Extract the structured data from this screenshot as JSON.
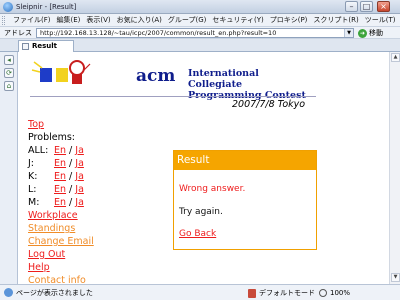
{
  "window": {
    "title": "Sleipnir - [Result]",
    "minimize": "–",
    "maximize": "□",
    "close": "×"
  },
  "menu": {
    "items": [
      "ファイル(F)",
      "編集(E)",
      "表示(V)",
      "お気に入り(A)",
      "グループ(G)",
      "セキュリティ(Y)",
      "プロキシ(P)",
      "スクリプト(R)",
      "ツール(T)",
      "ウィ"
    ]
  },
  "address": {
    "label": "アドレス",
    "url": "http://192.168.13.128/~tau/icpc/2007/common/result_en.php?result=10",
    "dropdown": "▼",
    "go_icon": "➜",
    "go_label": "移動"
  },
  "tabs": [
    {
      "label": "Result"
    }
  ],
  "sidebar": {
    "buttons": [
      "◂",
      "⟳",
      "⌂"
    ]
  },
  "page": {
    "acm": "acm",
    "icpc": "International Collegiate\nProgramming Contest",
    "date": "2007/7/8 Tokyo",
    "nav": {
      "top": "Top",
      "problems": "Problems:",
      "problem_rows": [
        {
          "key": "ALL:",
          "en": "En",
          "sep": " / ",
          "ja": "Ja"
        },
        {
          "key": "J:",
          "en": "En",
          "sep": " / ",
          "ja": "Ja"
        },
        {
          "key": "K:",
          "en": "En",
          "sep": " / ",
          "ja": "Ja"
        },
        {
          "key": "L:",
          "en": "En",
          "sep": " / ",
          "ja": "Ja"
        },
        {
          "key": "M:",
          "en": "En",
          "sep": " / ",
          "ja": "Ja"
        }
      ],
      "workplace": "Workplace",
      "standings": "Standings",
      "change_email": "Change Email",
      "logout": "Log Out",
      "help": "Help",
      "contact": "Contact info"
    },
    "result": {
      "header": "Result",
      "message": "Wrong answer.",
      "retry": "Try again.",
      "goback": "Go Back"
    }
  },
  "status": {
    "text": "ページが表示されました",
    "mode": "デフォルトモード",
    "zoom": "100%"
  },
  "scrollbar": {
    "up": "▲",
    "down": "▼"
  },
  "colors": {
    "link_red": "#ee1c1c",
    "link_orange": "#f08c28",
    "result_header": "#f5a500",
    "acm_blue": "#0f1d8c"
  }
}
